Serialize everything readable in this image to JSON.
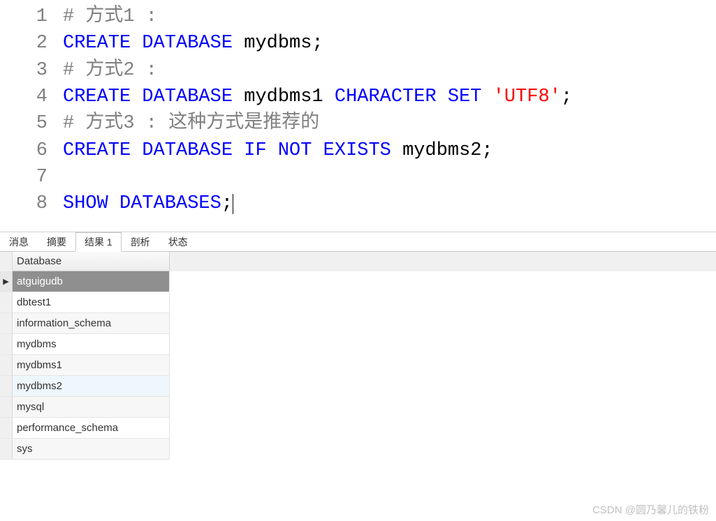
{
  "code": {
    "lines": [
      {
        "num": "1",
        "tokens": [
          {
            "cls": "comment",
            "t": "# 方式1 :"
          }
        ]
      },
      {
        "num": "2",
        "tokens": [
          {
            "cls": "keyword",
            "t": "CREATE"
          },
          {
            "cls": "",
            "t": " "
          },
          {
            "cls": "keyword",
            "t": "DATABASE"
          },
          {
            "cls": "",
            "t": " "
          },
          {
            "cls": "identifier",
            "t": "mydbms"
          },
          {
            "cls": "punct",
            "t": ";"
          }
        ]
      },
      {
        "num": "3",
        "tokens": [
          {
            "cls": "comment",
            "t": "# 方式2 :"
          }
        ]
      },
      {
        "num": "4",
        "tokens": [
          {
            "cls": "keyword",
            "t": "CREATE"
          },
          {
            "cls": "",
            "t": " "
          },
          {
            "cls": "keyword",
            "t": "DATABASE"
          },
          {
            "cls": "",
            "t": " "
          },
          {
            "cls": "identifier",
            "t": "mydbms1"
          },
          {
            "cls": "",
            "t": " "
          },
          {
            "cls": "keyword",
            "t": "CHARACTER"
          },
          {
            "cls": "",
            "t": " "
          },
          {
            "cls": "keyword",
            "t": "SET"
          },
          {
            "cls": "",
            "t": " "
          },
          {
            "cls": "string",
            "t": "'UTF8'"
          },
          {
            "cls": "punct",
            "t": ";"
          }
        ]
      },
      {
        "num": "5",
        "tokens": [
          {
            "cls": "comment",
            "t": "# 方式3 : 这种方式是推荐的"
          }
        ]
      },
      {
        "num": "6",
        "tokens": [
          {
            "cls": "keyword",
            "t": "CREATE"
          },
          {
            "cls": "",
            "t": " "
          },
          {
            "cls": "keyword",
            "t": "DATABASE"
          },
          {
            "cls": "",
            "t": " "
          },
          {
            "cls": "keyword",
            "t": "IF"
          },
          {
            "cls": "",
            "t": " "
          },
          {
            "cls": "keyword",
            "t": "NOT"
          },
          {
            "cls": "",
            "t": " "
          },
          {
            "cls": "keyword",
            "t": "EXISTS"
          },
          {
            "cls": "",
            "t": " "
          },
          {
            "cls": "identifier",
            "t": "mydbms2"
          },
          {
            "cls": "punct",
            "t": ";"
          }
        ]
      },
      {
        "num": "7",
        "tokens": []
      },
      {
        "num": "8",
        "tokens": [
          {
            "cls": "keyword",
            "t": "SHOW"
          },
          {
            "cls": "",
            "t": " "
          },
          {
            "cls": "keyword",
            "t": "DATABASES"
          },
          {
            "cls": "punct",
            "t": ";"
          }
        ],
        "cursor": true
      }
    ]
  },
  "tabs": {
    "items": [
      {
        "label": "消息",
        "active": false
      },
      {
        "label": "摘要",
        "active": false
      },
      {
        "label": "结果 1",
        "active": true
      },
      {
        "label": "剖析",
        "active": false
      },
      {
        "label": "状态",
        "active": false
      }
    ]
  },
  "results": {
    "column_header": "Database",
    "rows": [
      {
        "value": "atguigudb",
        "selected": true,
        "pointer": "▶"
      },
      {
        "value": "dbtest1"
      },
      {
        "value": "information_schema",
        "alt": true
      },
      {
        "value": "mydbms"
      },
      {
        "value": "mydbms1",
        "alt": true
      },
      {
        "value": "mydbms2",
        "highlight": true
      },
      {
        "value": "mysql",
        "alt": true
      },
      {
        "value": "performance_schema"
      },
      {
        "value": "sys",
        "alt": true
      }
    ]
  },
  "watermark": "CSDN @圆乃馨儿的铁粉"
}
